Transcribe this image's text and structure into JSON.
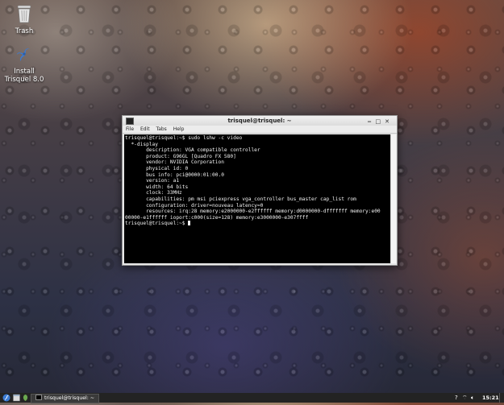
{
  "desktop": {
    "icons": [
      {
        "label": "Trash"
      },
      {
        "label": "Install\nTrisquel 8.0"
      }
    ]
  },
  "window": {
    "title": "trisquel@trisquel: ~",
    "menu": [
      "File",
      "Edit",
      "Tabs",
      "Help"
    ],
    "terminal_lines": [
      "trisquel@trisquel:~$ sudo lshw -c video",
      "  *-display",
      "       description: VGA compatible controller",
      "       product: G96GL [Quadro FX 580]",
      "       vendor: NVIDIA Corporation",
      "       physical id: 0",
      "       bus info: pci@0000:01:00.0",
      "       version: a1",
      "       width: 64 bits",
      "       clock: 33MHz",
      "       capabilities: pm msi pciexpress vga_controller bus_master cap_list rom",
      "       configuration: driver=nouveau latency=0",
      "       resources: irq:28 memory:e2000000-e2ffffff memory:d0000000-dfffffff memory:e00",
      "00000-e1ffffff ioport:c000(size=128) memory:e3000000-e307ffff",
      "trisquel@trisquel:~$ "
    ]
  },
  "taskbar": {
    "task_label": "trisquel@trisquel: ~",
    "clock": "15:21",
    "tray_icons": [
      "help-icon",
      "network-icon",
      "volume-icon"
    ]
  }
}
